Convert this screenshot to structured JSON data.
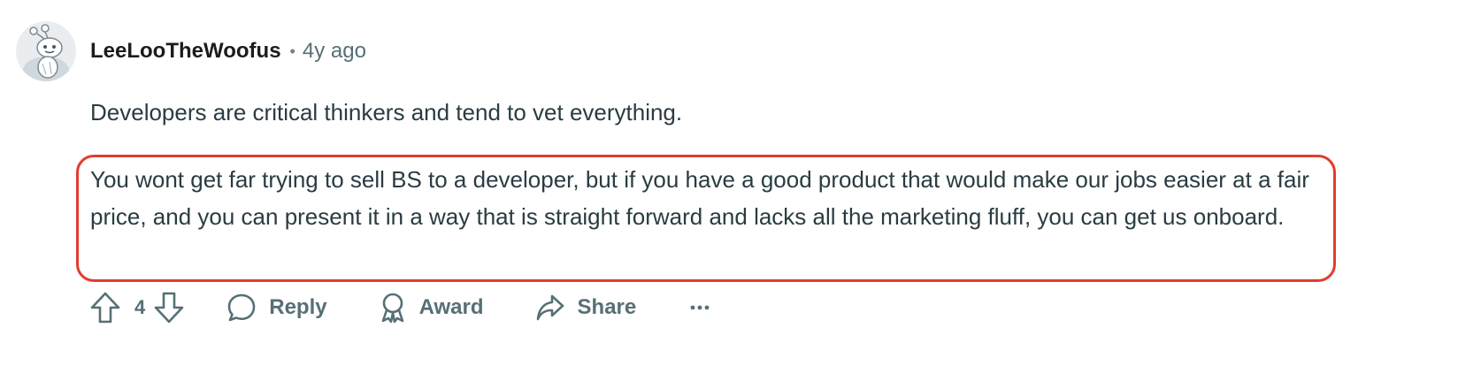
{
  "comment": {
    "author": "LeeLooTheWoofus",
    "separator": "•",
    "timestamp": "4y ago",
    "paragraphs": [
      "Developers are critical thinkers and tend to vet everything.",
      "You wont get far trying to sell BS to a developer, but if you have a good product that would make our jobs easier at a fair price, and you can present it in a way that is straight forward and lacks all the marketing fluff, you can get us onboard."
    ],
    "highlight_color": "#e23c2e"
  },
  "actions": {
    "vote_count": "4",
    "reply_label": "Reply",
    "award_label": "Award",
    "share_label": "Share",
    "icons": {
      "upvote": "upvote-arrow-icon",
      "downvote": "downvote-arrow-icon",
      "reply": "speech-bubble-icon",
      "award": "award-ribbon-icon",
      "share": "share-arrow-icon",
      "more": "ellipsis-icon"
    }
  },
  "colors": {
    "text_primary": "#1c1c1c",
    "text_body": "#2a3c42",
    "text_meta": "#576f76",
    "highlight_border": "#e23c2e"
  }
}
